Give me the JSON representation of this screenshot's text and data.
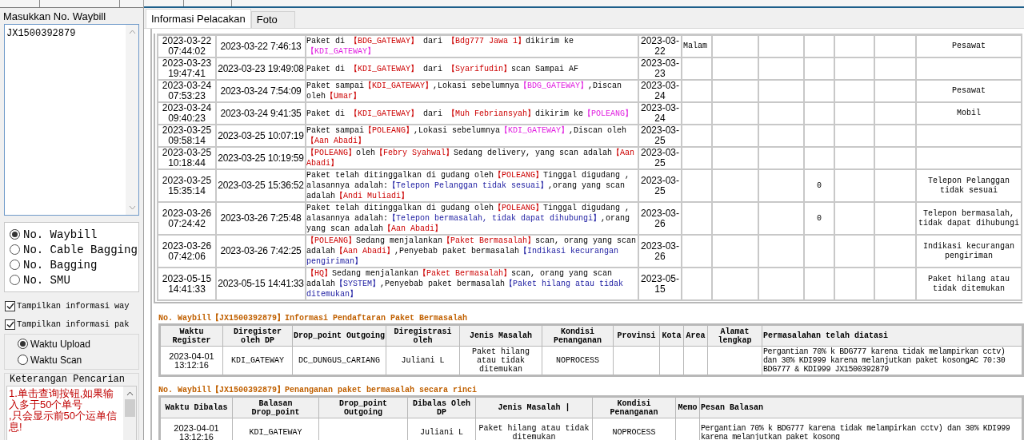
{
  "sidebar": {
    "input_label": "Masukkan No. Waybill",
    "waybill_input": "JX1500392879",
    "search_types": [
      {
        "label": "No. Waybill",
        "selected": true
      },
      {
        "label": "No. Cable Bagging",
        "selected": false
      },
      {
        "label": "No. Bagging",
        "selected": false
      },
      {
        "label": "No. SMU",
        "selected": false
      }
    ],
    "options": [
      {
        "label": "Tampilkan informasi way",
        "checked": true
      },
      {
        "label": "Tampilkan informasi pak",
        "checked": true
      }
    ],
    "time_modes": [
      {
        "label": "Waktu Upload",
        "selected": true
      },
      {
        "label": "Waktu Scan",
        "selected": false
      }
    ],
    "notes": {
      "title": "Keterangan Pencarian",
      "text": "1.单击查询按钮,如果输入多于50个单号\n,只会显示前50个运单信息!"
    }
  },
  "tabs": [
    {
      "label": "Informasi Pelacakan",
      "selected": true
    },
    {
      "label": "Foto",
      "selected": false
    }
  ],
  "tracking_table": {
    "rows": [
      {
        "scan_time": "2023-03-22\n07:44:02",
        "upload_time": "2023-03-22 7:46:13",
        "message": [
          {
            "kind": "text",
            "text": "Paket di "
          },
          {
            "kind": "site",
            "text": "【BDG_GATEWAY】"
          },
          {
            "kind": "text",
            "text": " dari "
          },
          {
            "kind": "person",
            "text": "【Bdg777 Jawa 1】"
          },
          {
            "kind": "text",
            "text": "dikirim ke "
          },
          {
            "kind": "next",
            "text": "【KDI_GATEWAY】"
          }
        ],
        "date": "2023-03-22",
        "column_5": "Malam",
        "column_11": "Pesawat"
      },
      {
        "scan_time": "2023-03-23\n19:47:41",
        "upload_time": "2023-03-23 19:49:08",
        "message": [
          {
            "kind": "text",
            "text": "Paket di "
          },
          {
            "kind": "site",
            "text": "【KDI_GATEWAY】"
          },
          {
            "kind": "text",
            "text": " dari "
          },
          {
            "kind": "person",
            "text": "【Syarifudin】"
          },
          {
            "kind": "text",
            "text": "scan Sampai AF"
          }
        ],
        "date": "2023-03-23"
      },
      {
        "scan_time": "2023-03-24\n07:53:23",
        "upload_time": "2023-03-24 7:54:09",
        "message": [
          {
            "kind": "text",
            "text": "Paket sampai"
          },
          {
            "kind": "site",
            "text": "【KDI_GATEWAY】"
          },
          {
            "kind": "text",
            "text": ",Lokasi sebelumnya"
          },
          {
            "kind": "next",
            "text": "【BDG_GATEWAY】"
          },
          {
            "kind": "text",
            "text": ",Discan oleh"
          },
          {
            "kind": "person",
            "text": "【Umar】"
          }
        ],
        "date": "2023-03-24",
        "column_11": "Pesawat"
      },
      {
        "scan_time": "2023-03-24\n09:40:23",
        "upload_time": "2023-03-24 9:41:35",
        "message": [
          {
            "kind": "text",
            "text": "Paket di "
          },
          {
            "kind": "site",
            "text": "【KDI_GATEWAY】"
          },
          {
            "kind": "text",
            "text": " dari "
          },
          {
            "kind": "person",
            "text": "【Muh Febriansyah】"
          },
          {
            "kind": "text",
            "text": "dikirim ke"
          },
          {
            "kind": "next",
            "text": "【POLEANG】"
          }
        ],
        "date": "2023-03-24",
        "column_11": "Mobil"
      },
      {
        "scan_time": "2023-03-25\n09:58:14",
        "upload_time": "2023-03-25 10:07:19",
        "message": [
          {
            "kind": "text",
            "text": "Paket sampai"
          },
          {
            "kind": "site",
            "text": "【POLEANG】"
          },
          {
            "kind": "text",
            "text": ",Lokasi sebelumnya"
          },
          {
            "kind": "next",
            "text": "【KDI_GATEWAY】"
          },
          {
            "kind": "text",
            "text": ",Discan oleh "
          },
          {
            "kind": "person",
            "text": "【Aan Abadi】"
          }
        ],
        "date": "2023-03-25"
      },
      {
        "scan_time": "2023-03-25\n10:18:44",
        "upload_time": "2023-03-25 10:19:59",
        "message": [
          {
            "kind": "site",
            "text": "【POLEANG】"
          },
          {
            "kind": "text",
            "text": "oleh"
          },
          {
            "kind": "person",
            "text": "【Febry Syahwal】"
          },
          {
            "kind": "text",
            "text": "Sedang delivery, yang scan adalah"
          },
          {
            "kind": "person",
            "text": "【Aan Abadi】"
          }
        ],
        "date": "2023-03-25"
      },
      {
        "scan_time": "2023-03-25\n15:35:14",
        "upload_time": "2023-03-25 15:36:52",
        "message": [
          {
            "kind": "text",
            "text": "Paket telah ditinggalkan di gudang oleh"
          },
          {
            "kind": "site",
            "text": "【POLEANG】"
          },
          {
            "kind": "text",
            "text": "Tinggal digudang , alasannya adalah:"
          },
          {
            "kind": "reason",
            "text": "【Telepon Pelanggan tidak sesuai】"
          },
          {
            "kind": "text",
            "text": ",orang yang scan adalah"
          },
          {
            "kind": "site",
            "text": "【Andi Muliadi】"
          }
        ],
        "date": "2023-03-25",
        "column_8": "0",
        "column_11": "Telepon Pelanggan tidak sesuai"
      },
      {
        "scan_time": "2023-03-26\n07:24:42",
        "upload_time": "2023-03-26 7:25:48",
        "message": [
          {
            "kind": "text",
            "text": "Paket telah ditinggalkan di gudang oleh"
          },
          {
            "kind": "site",
            "text": "【POLEANG】"
          },
          {
            "kind": "text",
            "text": "Tinggal digudang , alasannya adalah:"
          },
          {
            "kind": "reason",
            "text": "【Telepon bermasalah, tidak dapat dihubungi】"
          },
          {
            "kind": "text",
            "text": ",orang yang scan adalah"
          },
          {
            "kind": "site",
            "text": "【Aan Abadi】"
          }
        ],
        "date": "2023-03-26",
        "column_8": "0",
        "column_11": "Telepon bermasalah, tidak dapat dihubungi"
      },
      {
        "scan_time": "2023-03-26\n07:42:06",
        "upload_time": "2023-03-26 7:42:25",
        "message": [
          {
            "kind": "site",
            "text": "【POLEANG】"
          },
          {
            "kind": "text",
            "text": "Sedang menjalankan"
          },
          {
            "kind": "site",
            "text": "【Paket Bermasalah】"
          },
          {
            "kind": "text",
            "text": "scan, orang yang scan adalah"
          },
          {
            "kind": "person",
            "text": "【Aan Abadi】"
          },
          {
            "kind": "text",
            "text": ",Penyebab paket bermasalah"
          },
          {
            "kind": "reason",
            "text": "【Indikasi kecurangan pengiriman】"
          }
        ],
        "date": "2023-03-26",
        "column_11": "Indikasi kecurangan pengiriman"
      },
      {
        "scan_time": "2023-05-15\n14:41:33",
        "upload_time": "2023-05-15 14:41:33",
        "message": [
          {
            "kind": "site",
            "text": "【HQ】"
          },
          {
            "kind": "text",
            "text": "Sedang menjalankan"
          },
          {
            "kind": "site",
            "text": "【Paket Bermasalah】"
          },
          {
            "kind": "text",
            "text": "scan, orang yang scan adalah"
          },
          {
            "kind": "reason",
            "text": "【SYSTEM】"
          },
          {
            "kind": "text",
            "text": ",Penyebab paket bermasalah"
          },
          {
            "kind": "reason",
            "text": "【Paket hilang atau tidak ditemukan】"
          }
        ],
        "date": "2023-05-15",
        "column_11": "Paket hilang atau tidak ditemukan"
      }
    ]
  },
  "registration": {
    "title": "No. Waybill【JX1500392879】Informasi Pendaftaran Paket Bermasalah",
    "columns": [
      "Waktu Register",
      "Diregister oleh DP",
      "Drop_point Outgoing",
      "Diregistrasi oleh",
      "Jenis Masalah",
      "Kondisi Penanganan",
      "Provinsi",
      "Kota",
      "Area",
      "Alamat lengkap",
      "Permasalahan telah diatasi"
    ],
    "rows": [
      [
        "2023-04-01\n13:12:16",
        "KDI_GATEWAY",
        "DC_DUNGUS_CARIANG",
        "Juliani L",
        "Paket hilang atau tidak ditemukan",
        "NOPROCESS",
        "",
        "",
        "",
        "",
        "Pergantian 70% k BDG777 karena tidak melampirkan cctv) dan 30% KDI999 karena melanjutkan paket kosongAC 70:30 BDG777 & KDI999 JX1500392879"
      ]
    ]
  },
  "handling": {
    "title": "No. Waybill【JX1500392879】Penanganan paket bermasalah secara rinci",
    "columns": [
      "Waktu Dibalas",
      "Balasan Drop_point",
      "Drop_point Outgoing",
      "Dibalas Oleh DP",
      "Jenis Masalah |",
      "Kondisi Penanganan",
      "Memo",
      "Pesan Balasan"
    ],
    "rows": [
      [
        "2023-04-01\n13:12:16",
        "KDI_GATEWAY",
        "",
        "Juliani L",
        "Paket hilang atau tidak ditemukan",
        "NOPROCESS",
        "",
        "Pergantian 70% k BDG777 karena tidak melampirkan cctv) dan 30% KDI999 karena melanjutkan paket kosong"
      ]
    ]
  }
}
